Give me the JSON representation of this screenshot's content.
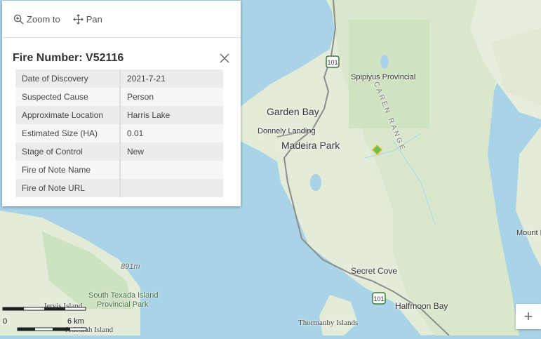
{
  "popup": {
    "actions": {
      "zoom_to": "Zoom to",
      "pan": "Pan"
    },
    "title": "Fire Number: V52116",
    "rows": [
      {
        "key": "Date of Discovery",
        "value": "2021-7-21"
      },
      {
        "key": "Suspected Cause",
        "value": "Person"
      },
      {
        "key": "Approximate Location",
        "value": "Harris Lake"
      },
      {
        "key": "Estimated Size (HA)",
        "value": "0.01"
      },
      {
        "key": "Stage of Control",
        "value": "New"
      },
      {
        "key": "Fire of Note Name",
        "value": ""
      },
      {
        "key": "Fire of Note URL",
        "value": ""
      }
    ]
  },
  "map": {
    "labels": {
      "garden_bay": "Garden Bay",
      "donnely_landing": "Donnely Landing",
      "madeira_park": "Madeira Park",
      "spipiyus": "Spipiyus Provincial",
      "caren_range": "CAREN RANGE",
      "secret_cove": "Secret Cove",
      "halfmoon_bay": "Halfmoon Bay",
      "thormanby": "Thormanby Islands",
      "south_texada": "South Texada Island",
      "provincial_park": "Provincial Park",
      "jervis_island": "Jervis Island",
      "jedediah_island": "Jedediah Island",
      "mount_r": "Mount R",
      "elevation": "891m"
    },
    "highway": "101",
    "scale": {
      "zero": "0",
      "dist": "6 km"
    },
    "zoom_in": "+",
    "colors": {
      "water": "#a9d3e6",
      "land": "#e3ecd9",
      "forest": "#cde2bf",
      "road": "#8c8c8c",
      "fire_marker": "#5ec46a"
    }
  }
}
